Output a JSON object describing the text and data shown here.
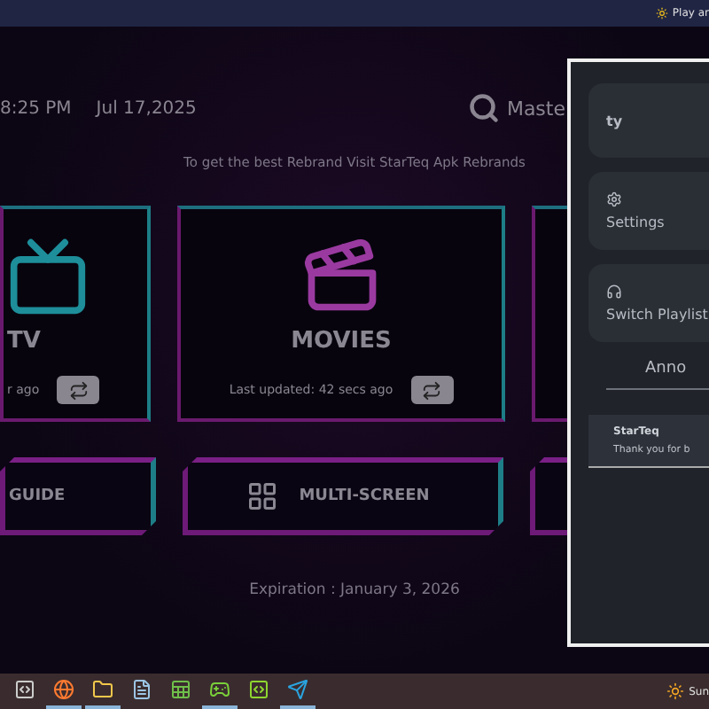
{
  "top_bar": {
    "notice": "Play ar"
  },
  "header": {
    "time": "8:25 PM",
    "date": "Jul 17,2025",
    "search_label": "Maste"
  },
  "promo": "To get the best Rebrand Visit StarTeq Apk Rebrands",
  "cards": [
    {
      "kind": "tv",
      "title": "TV",
      "updated": "r ago"
    },
    {
      "kind": "movies",
      "title": "MOVIES",
      "updated": "Last updated: 42 secs ago"
    },
    {
      "kind": "blank"
    }
  ],
  "buttons": [
    {
      "kind": "guide",
      "label": "GUIDE"
    },
    {
      "kind": "multi",
      "label": "MULTI-SCREEN"
    },
    {
      "kind": "blank"
    }
  ],
  "expiration": "Expiration : January 3, 2026",
  "drawer": {
    "items": [
      {
        "kind": "text",
        "label": "ty"
      },
      {
        "kind": "settings",
        "label": "Settings"
      },
      {
        "kind": "playlist",
        "label": "Switch Playlist"
      }
    ],
    "announcements_title": "Anno",
    "announcement": {
      "sender": "StarTeq",
      "message": "Thank you for b"
    }
  },
  "taskbar": {
    "apps": [
      {
        "kind": "view",
        "selected": false
      },
      {
        "kind": "browser",
        "selected": true
      },
      {
        "kind": "folder",
        "selected": true
      },
      {
        "kind": "notes",
        "selected": false
      },
      {
        "kind": "sheet",
        "selected": false
      },
      {
        "kind": "emulator",
        "selected": true
      },
      {
        "kind": "editor",
        "selected": false
      },
      {
        "kind": "messenger",
        "selected": true
      }
    ],
    "weather": "Sun"
  }
}
